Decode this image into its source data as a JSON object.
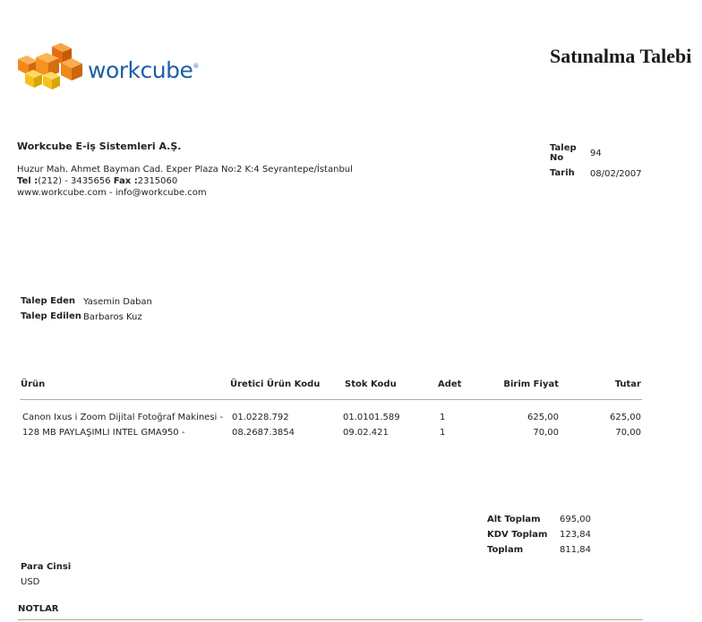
{
  "logo": {
    "text": "workcube",
    "mark": "®"
  },
  "document": {
    "title": "Satınalma Talebi"
  },
  "company": {
    "name": "Workcube E-iş Sistemleri A.Ş.",
    "address": "Huzur Mah. Ahmet Bayman Cad. Exper Plaza No:2 K:4 Seyrantepe/İstanbul",
    "tel_label": "Tel :",
    "tel_value": "(212) - 3435656",
    "fax_label": "Fax :",
    "fax_value": "2315060",
    "web": "www.workcube.com - info@workcube.com"
  },
  "request": {
    "no_label": "Talep No",
    "no_value": "94",
    "date_label": "Tarih",
    "date_value": "08/02/2007"
  },
  "parties": {
    "requester_label": "Talep Eden",
    "requester_value": "Yasemin Daban",
    "requested_label": "Talep Edilen",
    "requested_value": "Barbaros Kuz"
  },
  "table": {
    "headers": [
      "Ürün",
      "Üretici Ürün Kodu",
      "Stok Kodu",
      "Adet",
      "Birim Fiyat",
      "Tutar"
    ],
    "rows": [
      [
        "Canon Ixus i Zoom Dijital Fotoğraf Makinesi -",
        "01.0228.792",
        "01.0101.589",
        "1",
        "625,00",
        "625,00"
      ],
      [
        "128 MB PAYLAŞIMLI INTEL GMA950 -",
        "08.2687.3854",
        "09.02.421",
        "1",
        "70,00",
        "70,00"
      ]
    ]
  },
  "totals": {
    "subtotal_label": "Alt Toplam",
    "subtotal_value": "695,00",
    "vat_label": "KDV Toplam",
    "vat_value": "123,84",
    "total_label": "Toplam",
    "total_value": "811,84"
  },
  "currency": {
    "label": "Para Cinsi",
    "value": "USD"
  },
  "notes": {
    "label": "NOTLAR"
  },
  "colors": {
    "logo_blue": "#1f5fa8",
    "logo_orange": "#f08a1c",
    "logo_yellow": "#f6c21a",
    "rule": "#b5a99a"
  }
}
